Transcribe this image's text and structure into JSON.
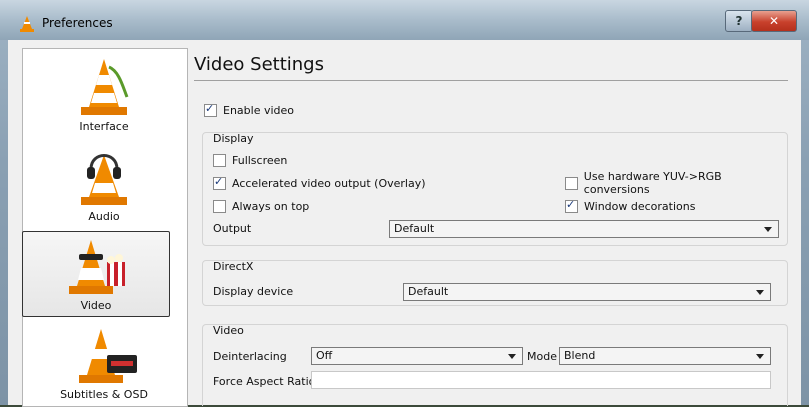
{
  "window": {
    "title": "Preferences",
    "help_label": "?",
    "close_label": "✕"
  },
  "sidebar": {
    "items": [
      {
        "label": "Interface"
      },
      {
        "label": "Audio"
      },
      {
        "label": "Video",
        "active": true
      },
      {
        "label": "Subtitles & OSD"
      }
    ]
  },
  "main": {
    "title": "Video Settings",
    "enable_video": {
      "label": "Enable video",
      "checked": true
    },
    "display": {
      "title": "Display",
      "fullscreen": {
        "label": "Fullscreen",
        "checked": false
      },
      "accelerated": {
        "label": "Accelerated video output (Overlay)",
        "checked": true
      },
      "always_on_top": {
        "label": "Always on top",
        "checked": false
      },
      "hw_yuv": {
        "label": "Use hardware YUV->RGB conversions",
        "checked": false
      },
      "window_decorations": {
        "label": "Window decorations",
        "checked": true
      },
      "output_label": "Output",
      "output_value": "Default"
    },
    "directx": {
      "title": "DirectX",
      "device_label": "Display device",
      "device_value": "Default"
    },
    "video": {
      "title": "Video",
      "deinterlacing_label": "Deinterlacing",
      "deinterlacing_value": "Off",
      "mode_label": "Mode",
      "mode_value": "Blend",
      "aspect_label": "Force Aspect Ratio",
      "aspect_value": ""
    }
  },
  "colors": {
    "close": "#c8412c",
    "accent": "#1b3a7a",
    "cone_orange": "#f08a00"
  }
}
